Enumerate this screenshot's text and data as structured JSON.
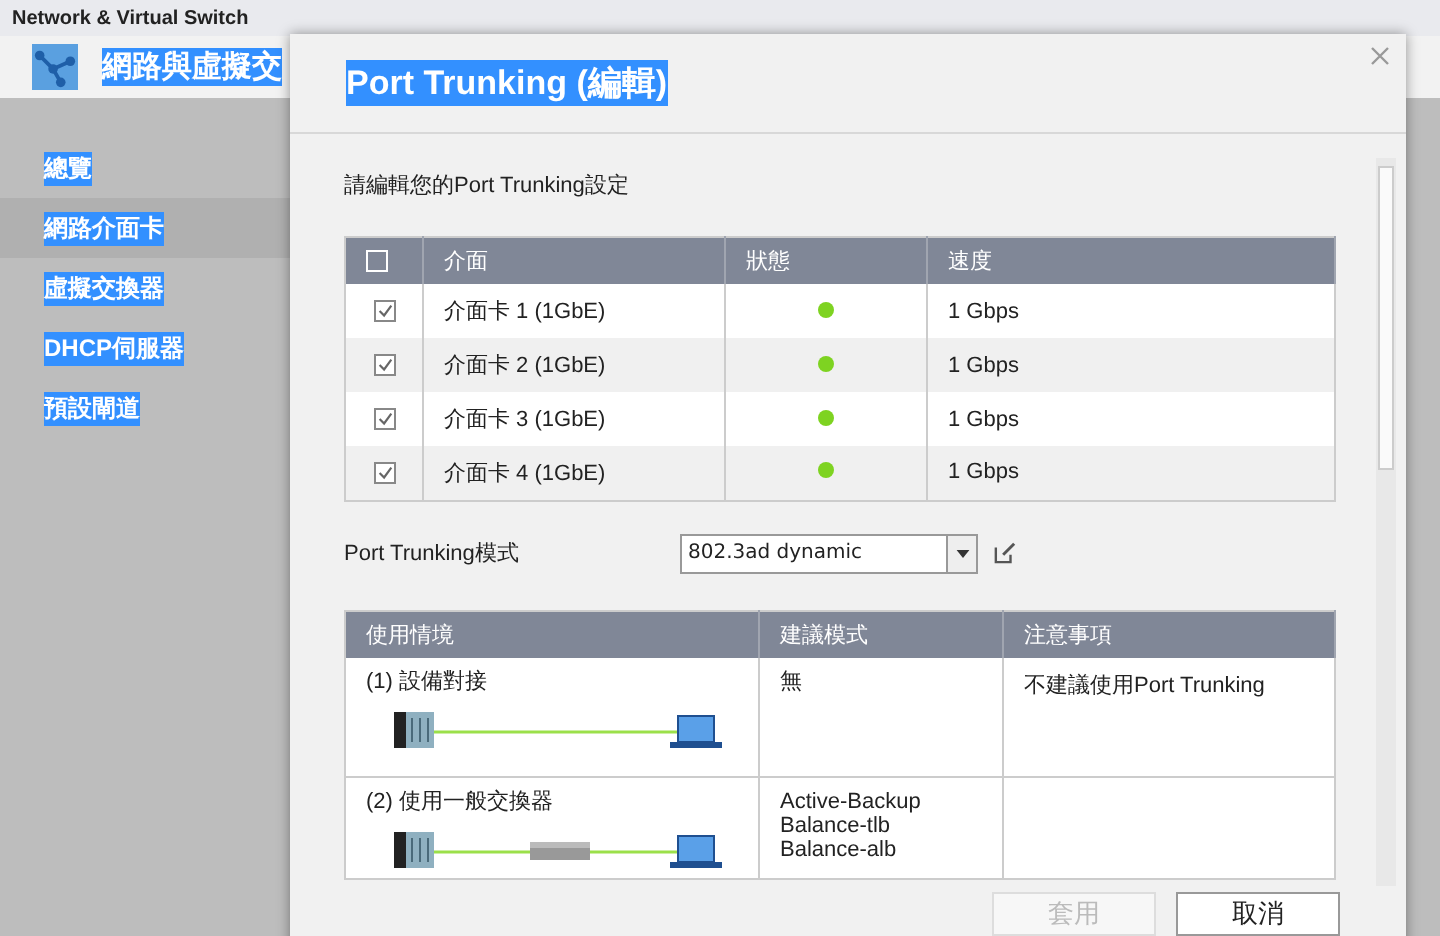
{
  "window": {
    "title": "Network & Virtual Switch"
  },
  "app": {
    "title": "網路與虛擬交"
  },
  "sidebar": {
    "items": [
      {
        "label": "總覽",
        "selected": false
      },
      {
        "label": "網路介面卡",
        "selected": true
      },
      {
        "label": "虛擬交換器",
        "selected": false
      },
      {
        "label": "DHCP伺服器",
        "selected": false
      },
      {
        "label": "預設閘道",
        "selected": false
      }
    ]
  },
  "dialog": {
    "title": "Port Trunking (編輯)",
    "intro": "請編輯您的Port Trunking設定",
    "interfaces": {
      "all_checked": false,
      "columns": [
        "介面",
        "狀態",
        "速度"
      ],
      "rows": [
        {
          "checked": true,
          "name": "介面卡 1 (1GbE)",
          "color": "#7ed321",
          "speed": "1 Gbps"
        },
        {
          "checked": true,
          "name": "介面卡 2 (1GbE)",
          "color": "#7ed321",
          "speed": "1 Gbps"
        },
        {
          "checked": true,
          "name": "介面卡 3 (1GbE)",
          "color": "#7ed321",
          "speed": "1 Gbps"
        },
        {
          "checked": true,
          "name": "介面卡 4 (1GbE)",
          "color": "#7ed321",
          "speed": "1 Gbps"
        }
      ]
    },
    "mode": {
      "label": "Port Trunking模式",
      "value": "802.3ad dynamic"
    },
    "scenarios": {
      "columns": [
        "使用情境",
        "建議模式",
        "注意事項"
      ],
      "rows": [
        {
          "scenario": "(1) 設備對接",
          "kind": "direct",
          "modes": [
            "無"
          ],
          "note": "不建議使用Port Trunking"
        },
        {
          "scenario": "(2) 使用一般交換器",
          "kind": "switch",
          "modes": [
            "Active-Backup",
            "Balance-tlb",
            "Balance-alb"
          ]
        }
      ]
    },
    "buttons": [
      {
        "label": "套用",
        "disabled": true
      },
      {
        "label": "取消",
        "disabled": false
      }
    ]
  }
}
